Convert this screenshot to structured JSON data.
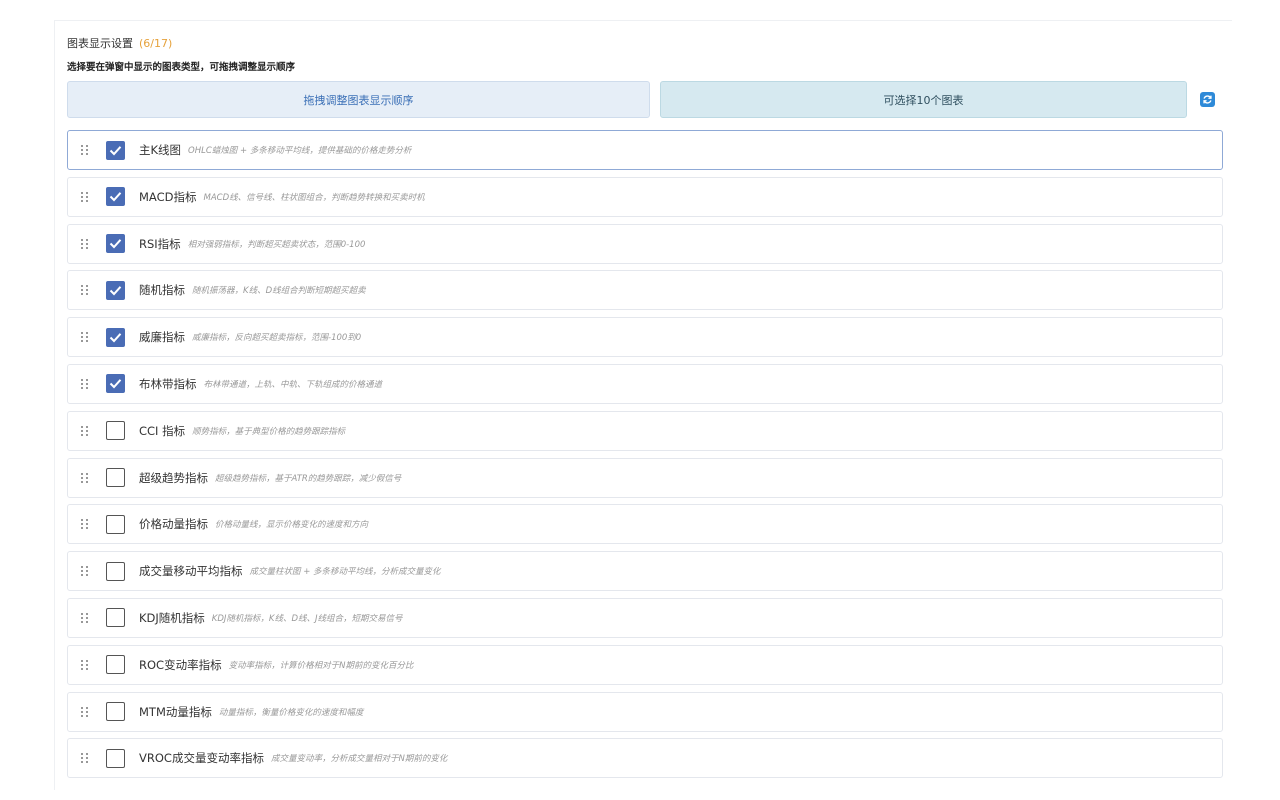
{
  "header": {
    "title": "图表显示设置",
    "count": "(6/17)",
    "subtitle": "选择要在弹窗中显示的图表类型，可拖拽调整显示顺序"
  },
  "buttons": {
    "order_label": "拖拽调整图表显示顺序",
    "limit_label": "可选择10个图表",
    "refresh_icon": "refresh-icon"
  },
  "colors": {
    "accent": "#4a6cb5",
    "count": "#e6a23c",
    "refresh": "#2e8ad8"
  },
  "charts": [
    {
      "name": "主K线图",
      "desc": "OHLC蜡烛图 + 多条移动平均线，提供基础的价格走势分析",
      "checked": true
    },
    {
      "name": "MACD指标",
      "desc": "MACD线、信号线、柱状图组合，判断趋势转换和买卖时机",
      "checked": true
    },
    {
      "name": "RSI指标",
      "desc": "相对强弱指标，判断超买超卖状态，范围0-100",
      "checked": true
    },
    {
      "name": "随机指标",
      "desc": "随机振荡器，K线、D线组合判断短期超买超卖",
      "checked": true
    },
    {
      "name": "威廉指标",
      "desc": "威廉指标，反向超买超卖指标，范围-100到0",
      "checked": true
    },
    {
      "name": "布林带指标",
      "desc": "布林带通道，上轨、中轨、下轨组成的价格通道",
      "checked": true
    },
    {
      "name": "CCI 指标",
      "desc": "顺势指标，基于典型价格的趋势跟踪指标",
      "checked": false
    },
    {
      "name": "超级趋势指标",
      "desc": "超级趋势指标，基于ATR的趋势跟踪，减少假信号",
      "checked": false
    },
    {
      "name": "价格动量指标",
      "desc": "价格动量线，显示价格变化的速度和方向",
      "checked": false
    },
    {
      "name": "成交量移动平均指标",
      "desc": "成交量柱状图 + 多条移动平均线，分析成交量变化",
      "checked": false
    },
    {
      "name": "KDJ随机指标",
      "desc": "KDJ随机指标，K线、D线、J线组合，短期交易信号",
      "checked": false
    },
    {
      "name": "ROC变动率指标",
      "desc": "变动率指标，计算价格相对于N期前的变化百分比",
      "checked": false
    },
    {
      "name": "MTM动量指标",
      "desc": "动量指标，衡量价格变化的速度和幅度",
      "checked": false
    },
    {
      "name": "VROC成交量变动率指标",
      "desc": "成交量变动率，分析成交量相对于N期前的变化",
      "checked": false
    }
  ]
}
